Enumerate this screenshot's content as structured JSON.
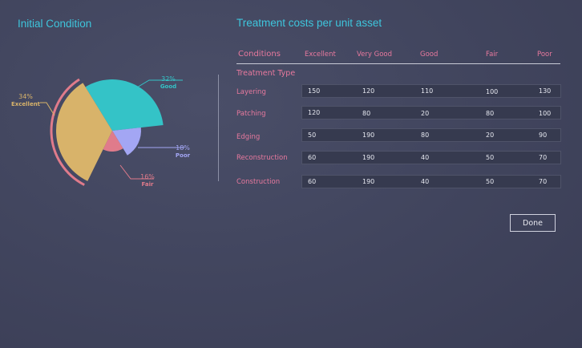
{
  "left_title": "Initial Condition",
  "right_title": "Treatment costs per unit asset",
  "table": {
    "conditions_label": "Conditions",
    "columns": [
      "Excellent",
      "Very Good",
      "Good",
      "Fair",
      "Poor"
    ],
    "section_label": "Treatment Type",
    "rows": [
      {
        "label": "Layering",
        "values": [
          "150",
          "120",
          "110",
          "100",
          "130"
        ]
      },
      {
        "label": "Patching",
        "values": [
          "120",
          "80",
          "20",
          "80",
          "100"
        ]
      },
      {
        "label": "Edging",
        "values": [
          "50",
          "190",
          "80",
          "20",
          "90"
        ]
      },
      {
        "label": "Reconstruction",
        "values": [
          "60",
          "190",
          "40",
          "50",
          "70"
        ]
      },
      {
        "label": "Construction",
        "values": [
          "60",
          "190",
          "40",
          "50",
          "70"
        ]
      }
    ]
  },
  "done_label": "Done",
  "chart_data": {
    "type": "pie",
    "title": "Initial Condition",
    "slices": [
      {
        "name": "Good",
        "pct_label": "32%",
        "value": 32,
        "color": "#34c3c7"
      },
      {
        "name": "Poor",
        "pct_label": "18%",
        "value": 18,
        "color": "#a3a6f4"
      },
      {
        "name": "Fair",
        "pct_label": "16%",
        "value": 16,
        "color": "#e07b8b"
      },
      {
        "name": "Excellent",
        "pct_label": "34%",
        "value": 34,
        "color": "#d8b36a"
      }
    ],
    "highlight_color": "#e07b8b"
  }
}
